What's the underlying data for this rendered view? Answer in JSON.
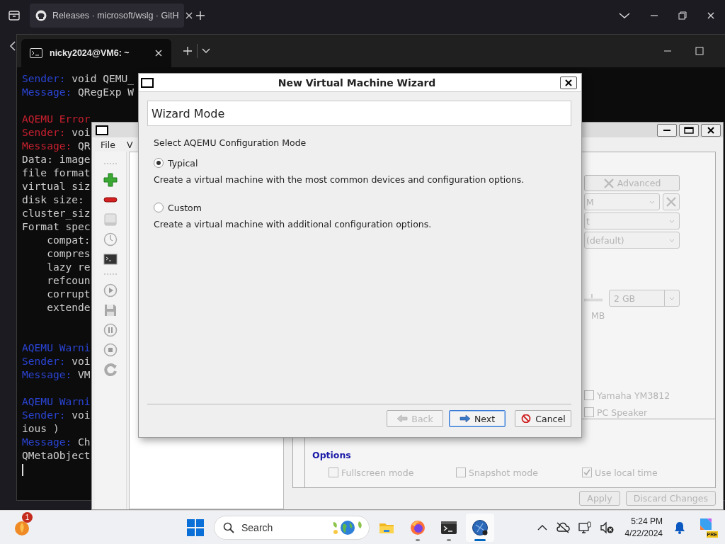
{
  "browser": {
    "tab": {
      "title": "Releases · microsoft/wslg · GitH",
      "selected": true
    }
  },
  "terminal": {
    "tab": {
      "title": "nicky2024@VM6: ~",
      "selected": true
    },
    "lines": [
      {
        "kind": "info",
        "label": "Sender:",
        "text": "void QEMU_"
      },
      {
        "kind": "info",
        "label": "Message:",
        "text": "QRegExp W"
      },
      {
        "kind": "blank"
      },
      {
        "kind": "error",
        "text": "AQEMU Error"
      },
      {
        "kind": "error",
        "label": "Sender:",
        "text": "voi"
      },
      {
        "kind": "error",
        "label": "Message:",
        "text": "QR"
      },
      {
        "kind": "plain",
        "text": "Data: image"
      },
      {
        "kind": "plain",
        "text": "file format"
      },
      {
        "kind": "plain",
        "text": "virtual siz"
      },
      {
        "kind": "plain",
        "text": "disk size:"
      },
      {
        "kind": "plain",
        "text": "cluster_siz"
      },
      {
        "kind": "plain",
        "text": "Format spec"
      },
      {
        "kind": "indented",
        "text": "compat:"
      },
      {
        "kind": "indented",
        "text": "compres"
      },
      {
        "kind": "indented",
        "text": "lazy re"
      },
      {
        "kind": "indented",
        "text": "refcoun"
      },
      {
        "kind": "indented",
        "text": "corrupt"
      },
      {
        "kind": "indented",
        "text": "extende"
      },
      {
        "kind": "blank"
      },
      {
        "kind": "blank"
      },
      {
        "kind": "info",
        "text": "AQEMU Warni"
      },
      {
        "kind": "info",
        "label": "Sender:",
        "text": "voi"
      },
      {
        "kind": "info",
        "label": "Message:",
        "text": "VM"
      },
      {
        "kind": "blank"
      },
      {
        "kind": "info",
        "text": "AQEMU Warni"
      },
      {
        "kind": "info",
        "label": "Sender:",
        "text": "voi"
      },
      {
        "kind": "plain",
        "text": "ious )"
      },
      {
        "kind": "info",
        "label": "Message:",
        "text": "Ch"
      },
      {
        "kind": "plain",
        "text": "QMetaObject"
      },
      {
        "kind": "cursor"
      }
    ]
  },
  "aqemu": {
    "menu": [
      {
        "label": "File"
      },
      {
        "label": "V"
      }
    ],
    "advanced_button": {
      "label": "Advanced",
      "disabled": true
    },
    "combos": [
      {
        "kind": "tool",
        "value": "M",
        "disabled": true
      },
      {
        "kind": "plain",
        "value": "t",
        "disabled": true
      },
      {
        "kind": "plain",
        "value": "(default)",
        "disabled": true
      }
    ],
    "memory": {
      "value": "2 GB",
      "unit": "MB",
      "disabled": true
    },
    "sound_cards": [
      {
        "label": "Yamaha YM3812",
        "checked": false,
        "disabled": true
      },
      {
        "label": "PC Speaker",
        "checked": false,
        "disabled": true
      }
    ],
    "options": {
      "title": "Options",
      "items": [
        {
          "label": "Fullscreen mode",
          "checked": false,
          "disabled": true
        },
        {
          "label": "Snapshot mode",
          "checked": false,
          "disabled": true
        },
        {
          "label": "Use local time",
          "checked": true,
          "disabled": true
        }
      ]
    },
    "buttons": [
      {
        "label": "Apply",
        "disabled": true
      },
      {
        "label": "Discard Changes",
        "disabled": true
      }
    ]
  },
  "wizard": {
    "title": "New Virtual Machine Wizard",
    "header": "Wizard Mode",
    "prompt": "Select AQEMU Configuration Mode",
    "modes": [
      {
        "label": "Typical",
        "description": "Create a virtual machine with the most common devices and configuration options.",
        "selected": true
      },
      {
        "label": "Custom",
        "description": "Create a virtual machine with additional configuration options.",
        "selected": false
      }
    ],
    "buttons": [
      {
        "kind": "back",
        "label": "Back",
        "disabled": true,
        "default": false
      },
      {
        "kind": "next",
        "label": "Next",
        "disabled": false,
        "default": true
      },
      {
        "kind": "cancel",
        "label": "Cancel",
        "disabled": false,
        "default": false
      }
    ]
  },
  "taskbar": {
    "notification_count": "1",
    "search": {
      "placeholder": "Search"
    },
    "apps": [
      {
        "kind": "explorer",
        "running": false,
        "active": false
      },
      {
        "kind": "firefox",
        "running": true,
        "active": false
      },
      {
        "kind": "terminal",
        "running": true,
        "active": false
      },
      {
        "kind": "aqemu",
        "running": true,
        "active": true
      }
    ],
    "time": "5:24 PM",
    "date": "4/22/2024",
    "copilot_badge": "PRE"
  }
}
